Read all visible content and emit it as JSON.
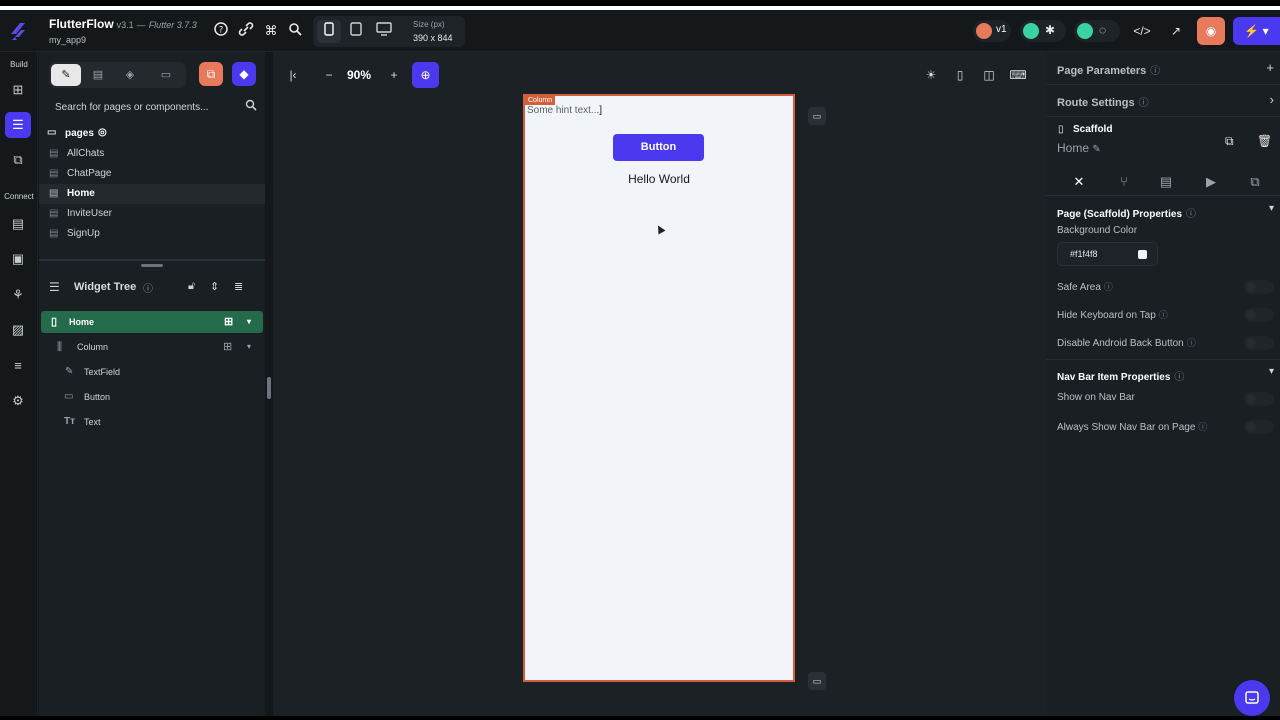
{
  "header": {
    "app_name": "FlutterFlow",
    "version": "v3.1",
    "separator": "—",
    "flutter_version": "Flutter 3.7.3",
    "project_name": "my_app9",
    "size_label": "Size (px)",
    "size_value": "390 x 844",
    "branch_label": "v1"
  },
  "rail": {
    "build_label": "Build",
    "connect_label": "Connect"
  },
  "left_panel": {
    "search_placeholder": "Search for pages or components...",
    "pages_header": "pages",
    "pages": [
      "AllChats",
      "ChatPage",
      "Home",
      "InviteUser",
      "SignUp"
    ],
    "selected_page": "Home",
    "widget_tree_title": "Widget Tree",
    "widget_tree": [
      {
        "label": "Home",
        "type": "page"
      },
      {
        "label": "Column",
        "type": "column"
      },
      {
        "label": "TextField",
        "type": "textfield"
      },
      {
        "label": "Button",
        "type": "button"
      },
      {
        "label": "Text",
        "type": "text"
      }
    ]
  },
  "canvas": {
    "zoom": "90%",
    "column_tag": "Column",
    "textfield_hint": "Some hint text...",
    "button_label": "Button",
    "text_value": "Hello World"
  },
  "right_panel": {
    "page_parameters": "Page Parameters",
    "route_settings": "Route Settings",
    "scaffold_title": "Scaffold",
    "scaffold_name": "Home",
    "scaffold_section": "Page (Scaffold) Properties",
    "background_color_label": "Background Color",
    "background_color_value": "#f1f4f8",
    "safe_area": "Safe Area",
    "hide_keyboard": "Hide Keyboard on Tap",
    "disable_back": "Disable Android Back Button",
    "nav_section": "Nav Bar Item Properties",
    "show_nav": "Show on Nav Bar",
    "always_show_nav": "Always Show Nav Bar on Page"
  },
  "colors": {
    "accent": "#4b39ef",
    "selection_outline": "#d55f3a",
    "tree_selected": "#246b4b",
    "success": "#39d2a0",
    "warning": "#e8795b"
  }
}
